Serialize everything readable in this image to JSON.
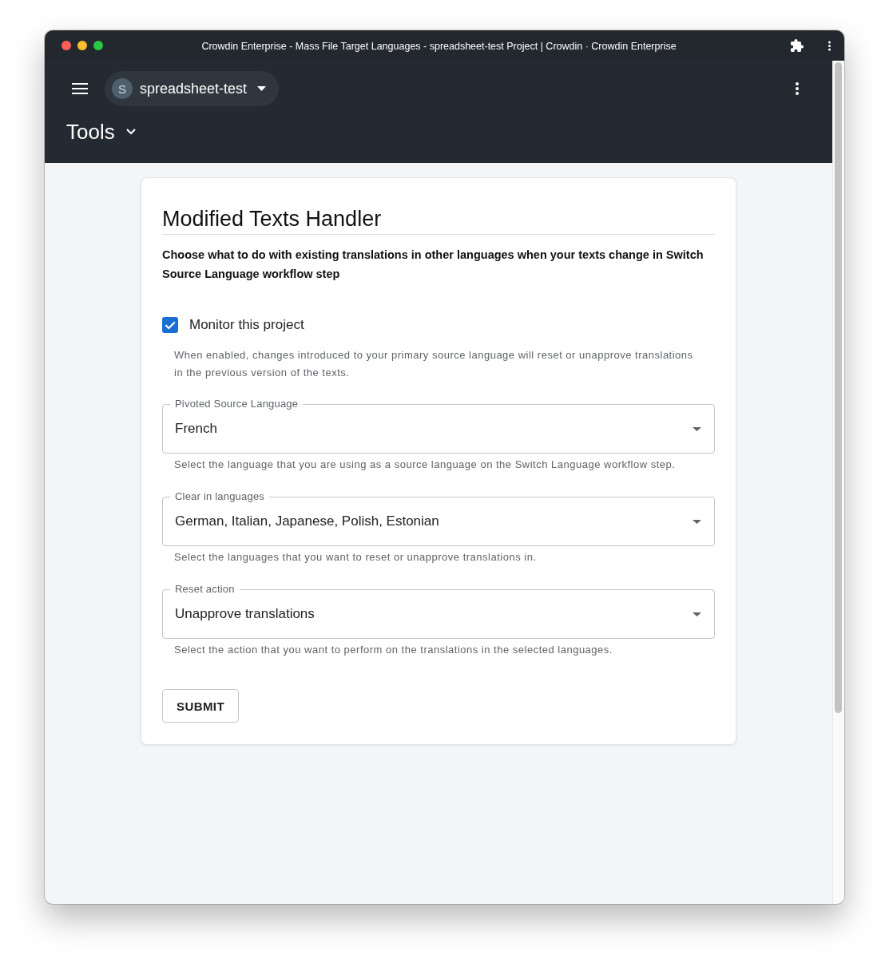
{
  "window": {
    "title": "Crowdin Enterprise - Mass File Target Languages - spreadsheet-test Project | Crowdin · Crowdin Enterprise"
  },
  "header": {
    "project": {
      "initial": "S",
      "name": "spreadsheet-test"
    },
    "section": "Tools"
  },
  "form": {
    "title": "Modified Texts Handler",
    "description": "Choose what to do with existing translations in other languages when your texts change in Switch Source Language workflow step",
    "monitor": {
      "label": "Monitor this project",
      "checked": true,
      "help": "When enabled, changes introduced to your primary source language will reset or unapprove translations in the previous version of the texts."
    },
    "fields": [
      {
        "label": "Pivoted Source Language",
        "value": "French",
        "help": "Select the language that you are using as a source language on the Switch Language workflow step."
      },
      {
        "label": "Clear in languages",
        "value": "German, Italian, Japanese, Polish, Estonian",
        "help": "Select the languages that you want to reset or unapprove translations in."
      },
      {
        "label": "Reset action",
        "value": "Unapprove translations",
        "help": "Select the action that you want to perform on the translations in the selected languages."
      }
    ],
    "submit": "SUBMIT"
  }
}
